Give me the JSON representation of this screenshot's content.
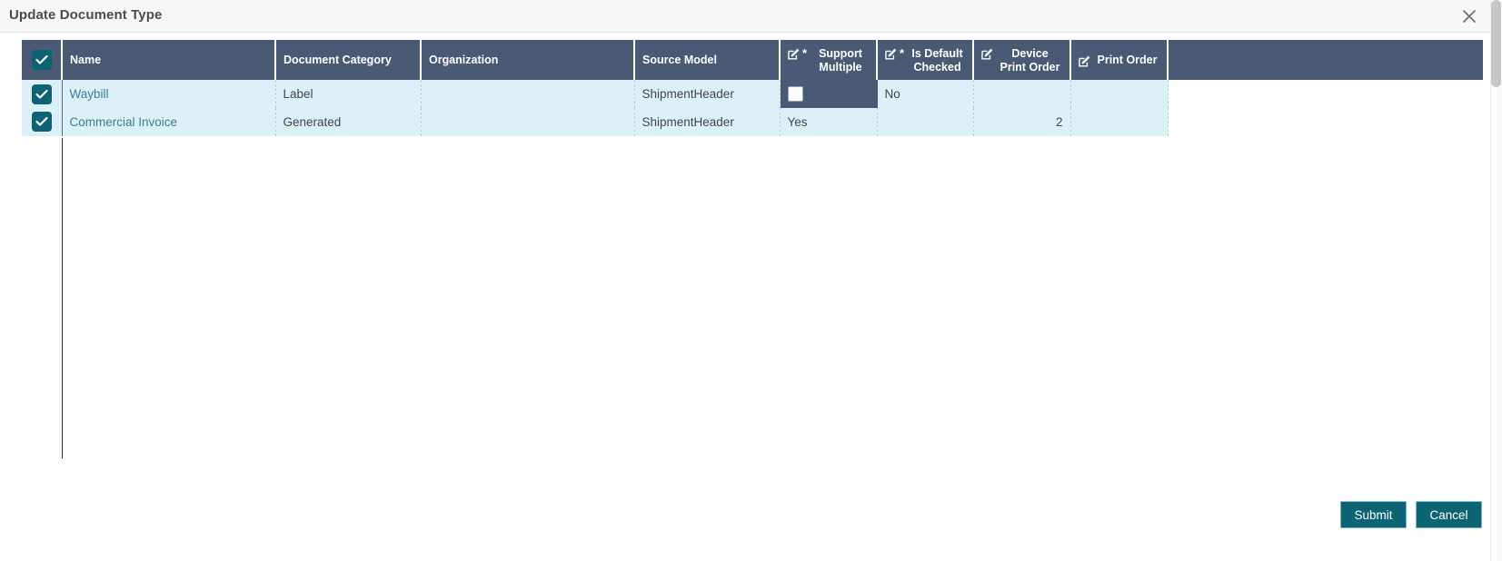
{
  "dialog": {
    "title": "Update Document Type",
    "close_icon": "close-icon"
  },
  "grid": {
    "header_select_all_icon": "check-icon",
    "columns": [
      {
        "key": "select",
        "label": "",
        "editable": false,
        "required": false,
        "align": "center"
      },
      {
        "key": "name",
        "label": "Name",
        "editable": false,
        "required": false,
        "align": "left"
      },
      {
        "key": "document_category",
        "label": "Document Category",
        "editable": false,
        "required": false,
        "align": "left"
      },
      {
        "key": "organization",
        "label": "Organization",
        "editable": false,
        "required": false,
        "align": "left"
      },
      {
        "key": "source_model",
        "label": "Source Model",
        "editable": false,
        "required": false,
        "align": "left"
      },
      {
        "key": "support_multiple",
        "label": "Support Multiple",
        "editable": true,
        "required": true,
        "align": "center"
      },
      {
        "key": "is_default_checked",
        "label": "Is Default Checked",
        "editable": true,
        "required": true,
        "align": "center"
      },
      {
        "key": "device_print_order",
        "label": "Device Print Order",
        "editable": true,
        "required": false,
        "align": "center"
      },
      {
        "key": "print_order",
        "label": "Print Order",
        "editable": true,
        "required": false,
        "align": "center"
      },
      {
        "key": "spacer",
        "label": "",
        "editable": false,
        "required": false,
        "align": "left"
      }
    ],
    "rows": [
      {
        "selected": true,
        "name": "Waybill",
        "document_category": "Label",
        "organization": "",
        "source_model": "ShipmentHeader",
        "support_multiple": "",
        "support_multiple_editing": true,
        "support_multiple_checked": false,
        "is_default_checked": "No",
        "device_print_order": "",
        "print_order": ""
      },
      {
        "selected": true,
        "name": "Commercial Invoice",
        "document_category": "Generated",
        "organization": "",
        "source_model": "ShipmentHeader",
        "support_multiple": "Yes",
        "support_multiple_editing": false,
        "support_multiple_checked": true,
        "is_default_checked": "",
        "device_print_order": "2",
        "print_order": ""
      }
    ]
  },
  "footer": {
    "submit_label": "Submit",
    "cancel_label": "Cancel"
  },
  "colors": {
    "header_bg": "#4a5a74",
    "row_bg": "#dcf0f7",
    "accent_teal": "#0c6373",
    "link_text": "#3b7f96"
  }
}
